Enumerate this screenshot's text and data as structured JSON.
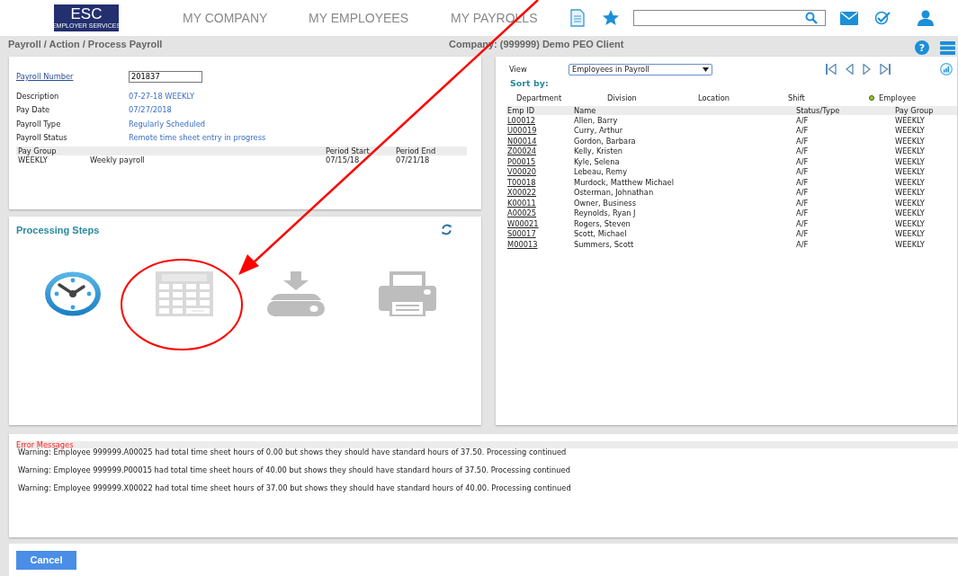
{
  "header": {
    "logo": "ESC",
    "logo_sub": "EMPLOYER SERVICES",
    "nav": [
      "MY COMPANY",
      "MY EMPLOYEES",
      "MY PAYROLLS"
    ]
  },
  "help": "?",
  "breadcrumb": "Payroll / Action / Process Payroll",
  "company": "Company: (999999) Demo PEO Client",
  "payroll": {
    "number_label": "Payroll Number",
    "number": "201837",
    "fields": [
      {
        "label": "Description",
        "value": "07-27-18 WEEKLY"
      },
      {
        "label": "Pay Date",
        "value": "07/27/2018"
      },
      {
        "label": "Payroll Type",
        "value": "Regularly Scheduled"
      },
      {
        "label": "Payroll Status",
        "value": "Remote time sheet entry in progress"
      }
    ],
    "columns": [
      "Pay Group",
      "",
      "Period Start",
      "Period End"
    ],
    "rows": [
      [
        "WEEKLY",
        "Weekly payroll",
        "07/15/18",
        "07/21/18"
      ]
    ]
  },
  "steps": {
    "title": "Processing Steps",
    "items": [
      {
        "kind": "clock",
        "active": true
      },
      {
        "kind": "calculator",
        "active": false
      },
      {
        "kind": "download",
        "active": false
      },
      {
        "kind": "printer",
        "active": false
      }
    ]
  },
  "employees": {
    "view_label": "View",
    "view": "Employees in Payroll",
    "sort_label": "Sort by:",
    "sort": [
      {
        "label": "Department",
        "selected": false
      },
      {
        "label": "Division",
        "selected": false
      },
      {
        "label": "Location",
        "selected": false
      },
      {
        "label": "Shift",
        "selected": false
      },
      {
        "label": "Employee",
        "selected": true
      }
    ],
    "columns": [
      "Emp ID",
      "Name",
      "Status/Type",
      "Pay Group"
    ],
    "rows": [
      [
        "L00012",
        "Allen, Barry",
        "A/F",
        "WEEKLY"
      ],
      [
        "U00019",
        "Curry, Arthur",
        "A/F",
        "WEEKLY"
      ],
      [
        "N00014",
        "Gordon, Barbara",
        "A/F",
        "WEEKLY"
      ],
      [
        "Z00024",
        "Kelly, Kristen",
        "A/F",
        "WEEKLY"
      ],
      [
        "P00015",
        "Kyle, Selena",
        "A/F",
        "WEEKLY"
      ],
      [
        "V00020",
        "Lebeau, Remy",
        "A/F",
        "WEEKLY"
      ],
      [
        "T00018",
        "Murdock, Matthew Michael",
        "A/F",
        "WEEKLY"
      ],
      [
        "X00022",
        "Osterman, Johnathan",
        "A/F",
        "WEEKLY"
      ],
      [
        "K00011",
        "Owner, Business",
        "A/F",
        "WEEKLY"
      ],
      [
        "A00025",
        "Reynolds, Ryan J",
        "A/F",
        "WEEKLY"
      ],
      [
        "W00021",
        "Rogers, Steven",
        "A/F",
        "WEEKLY"
      ],
      [
        "S00017",
        "Scott, Michael",
        "A/F",
        "WEEKLY"
      ],
      [
        "M00013",
        "Summers, Scott",
        "A/F",
        "WEEKLY"
      ]
    ]
  },
  "errors": {
    "title": "Error Messages",
    "messages": [
      "Warning: Employee 999999.A00025 had total time sheet hours of 0.00 but shows they should have standard hours of 37.50. Processing continued",
      "Warning: Employee 999999.P00015 had total time sheet hours of 40.00 but shows they should have standard hours of 37.50. Processing continued",
      "Warning: Employee 999999.X00022 had total time sheet hours of 37.00 but shows they should have standard hours of 40.00. Processing continued"
    ]
  },
  "cancel": "Cancel"
}
